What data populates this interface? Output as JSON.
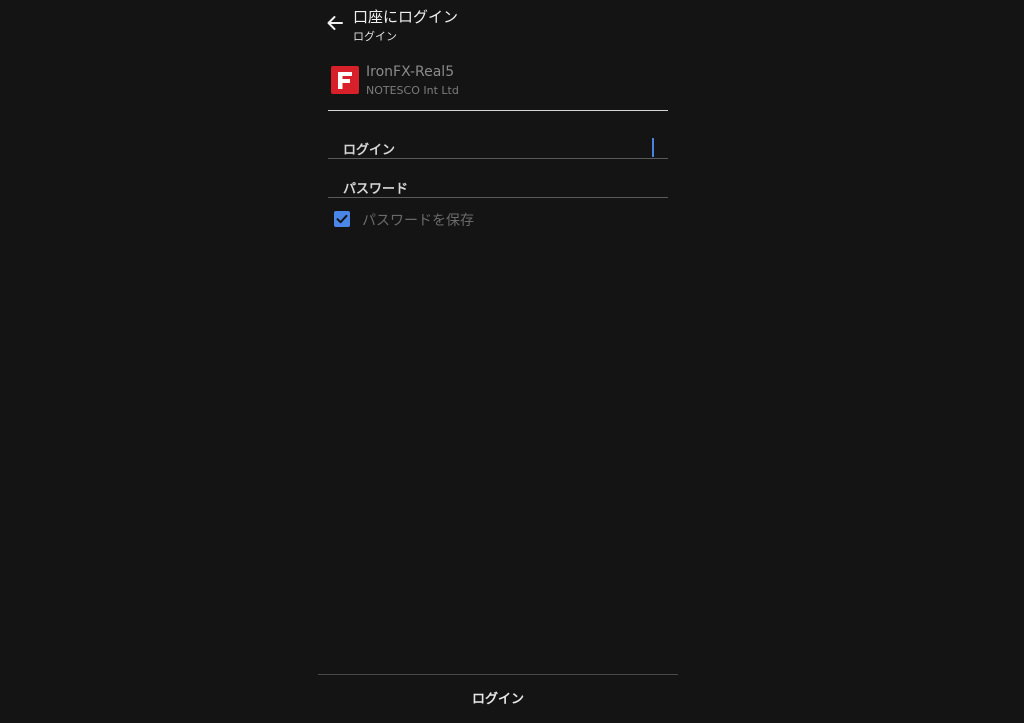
{
  "header": {
    "title": "口座にログイン",
    "subtitle": "ログイン",
    "back_icon": "arrow-left-icon"
  },
  "server": {
    "logo_icon": "ironfx-logo-icon",
    "name": "IronFX-Real5",
    "company": "NOTESCO Int Ltd"
  },
  "form": {
    "login_label": "ログイン",
    "login_value": "",
    "password_label": "パスワード",
    "password_value": "",
    "save_password_label": "パスワードを保存",
    "save_password_checked": true
  },
  "footer": {
    "login_button_label": "ログイン"
  },
  "colors": {
    "background": "#141414",
    "accent": "#4a86e8",
    "logo": "#d8202a"
  }
}
